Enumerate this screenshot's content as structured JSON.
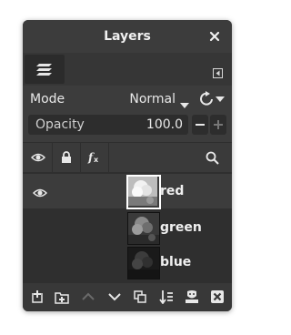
{
  "dialog": {
    "title": "Layers"
  },
  "mode": {
    "label": "Mode",
    "value": "Normal"
  },
  "opacity": {
    "label": "Opacity",
    "value": "100.0"
  },
  "header_icons": [
    "eye-icon",
    "lock-icon",
    "fx-icon",
    "search-icon"
  ],
  "layers": [
    {
      "name": "red",
      "visible": true,
      "selected": true
    },
    {
      "name": "green",
      "visible": false,
      "selected": false
    },
    {
      "name": "blue",
      "visible": false,
      "selected": false
    }
  ],
  "bottom_actions": [
    "new-layer-icon",
    "new-layer-group-icon",
    "raise-layer-icon",
    "lower-layer-icon",
    "duplicate-layer-icon",
    "merge-layer-icon",
    "add-mask-icon",
    "delete-layer-icon"
  ],
  "colors": {
    "panel": "#3c3c3c",
    "list": "#2f2f2f",
    "text": "#e8e8e8"
  }
}
